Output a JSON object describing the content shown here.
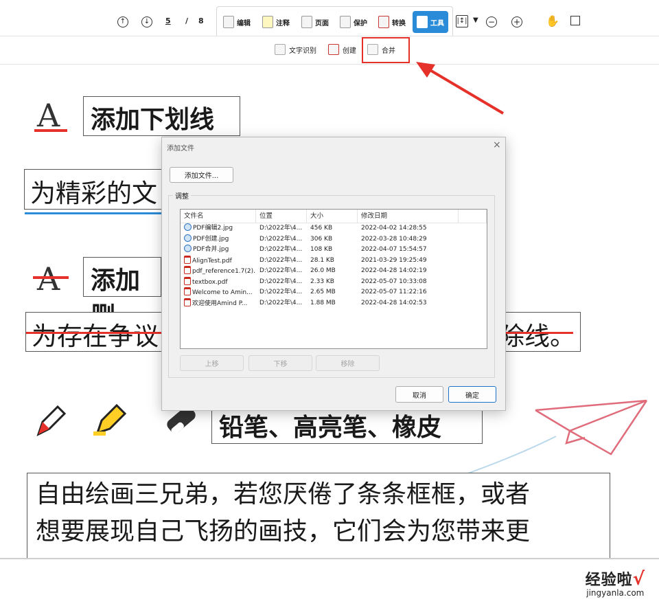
{
  "toolbar": {
    "page_current": "5",
    "page_separator": "/",
    "page_total": "8",
    "tabs": [
      {
        "label": "编辑",
        "icon": "edit-icon"
      },
      {
        "label": "注释",
        "icon": "comment-icon"
      },
      {
        "label": "页面",
        "icon": "page-icon"
      },
      {
        "label": "保护",
        "icon": "protect-icon"
      },
      {
        "label": "转换",
        "icon": "convert-icon"
      },
      {
        "label": "工具",
        "icon": "tools-icon",
        "active": true
      }
    ],
    "accent_color": "#2a8bd8"
  },
  "subtoolbar": {
    "items": [
      {
        "label": "文字识别",
        "icon": "ocr-icon"
      },
      {
        "label": "创建",
        "icon": "create-icon"
      },
      {
        "label": "合并",
        "icon": "merge-icon",
        "highlighted": true
      }
    ],
    "highlight_color": "#e5312a"
  },
  "document": {
    "heading_underline": "添加下划线",
    "line_underline": "为精彩的文",
    "heading_strike": "添加删",
    "line_strike_left": "为存在争议",
    "line_strike_right": "除线。",
    "heading_tools": "铅笔、高亮笔、橡皮",
    "para_line1": "自由绘画三兄弟，若您厌倦了条条框框，或者",
    "para_line2": "想要展现自己飞扬的画技，它们会为您带来更"
  },
  "dialog": {
    "title": "添加文件",
    "add_files_button": "添加文件...",
    "group_label": "调整",
    "columns": [
      "文件名",
      "位置",
      "大小",
      "修改日期"
    ],
    "files": [
      {
        "name": "PDF编辑2.jpg",
        "location": "D:\\2022年\\4...",
        "size": "456 KB",
        "modified": "2022-04-02 14:28:55",
        "type": "jpg"
      },
      {
        "name": "PDF创建.jpg",
        "location": "D:\\2022年\\4...",
        "size": "306 KB",
        "modified": "2022-03-28 10:48:29",
        "type": "jpg"
      },
      {
        "name": "PDF合并.jpg",
        "location": "D:\\2022年\\4...",
        "size": "108 KB",
        "modified": "2022-04-07 15:54:57",
        "type": "jpg"
      },
      {
        "name": "AlignTest.pdf",
        "location": "D:\\2022年\\4...",
        "size": "28.1 KB",
        "modified": "2021-03-29 19:25:49",
        "type": "pdf"
      },
      {
        "name": "pdf_reference1.7(2)...",
        "location": "D:\\2022年\\4...",
        "size": "26.0 MB",
        "modified": "2022-04-28 14:02:19",
        "type": "pdf"
      },
      {
        "name": "textbox.pdf",
        "location": "D:\\2022年\\4...",
        "size": "2.33 KB",
        "modified": "2022-05-07 10:33:08",
        "type": "pdf"
      },
      {
        "name": "Welcome to Amin...",
        "location": "D:\\2022年\\4...",
        "size": "2.65 MB",
        "modified": "2022-05-07 11:22:16",
        "type": "pdf"
      },
      {
        "name": "欢迎使用Amind P...",
        "location": "D:\\2022年\\4...",
        "size": "1.88 MB",
        "modified": "2022-04-28 14:02:53",
        "type": "pdf"
      }
    ],
    "move_up_button": "上移",
    "move_down_button": "下移",
    "remove_button": "移除",
    "cancel_button": "取消",
    "ok_button": "确定"
  },
  "watermark": {
    "text": "经验啦",
    "check": "√",
    "url": "jingyanla.com"
  }
}
